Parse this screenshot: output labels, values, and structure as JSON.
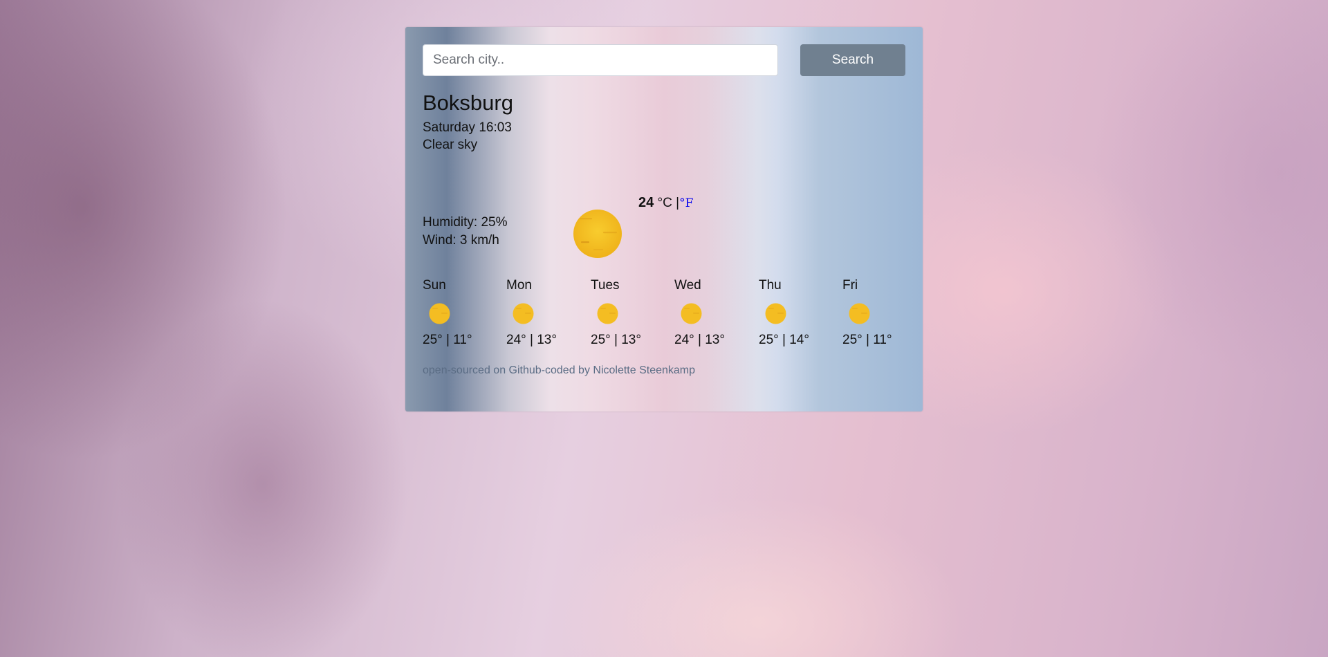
{
  "search": {
    "placeholder": "Search city..",
    "value": "",
    "button_label": "Search"
  },
  "current": {
    "city": "Boksburg",
    "datetime": "Saturday 16:03",
    "description": "Clear sky",
    "humidity": "Humidity: 25%",
    "wind": "Wind: 3 km/h",
    "temperature": "24",
    "unit_c": "°C |",
    "unit_f": "°F",
    "icon": "sun-icon"
  },
  "forecast": [
    {
      "day": "Sun",
      "temps": "25° | 11°",
      "icon": "sun-icon"
    },
    {
      "day": "Mon",
      "temps": "24° | 13°",
      "icon": "sun-icon"
    },
    {
      "day": "Tues",
      "temps": "25° | 13°",
      "icon": "sun-icon"
    },
    {
      "day": "Wed",
      "temps": "24° | 13°",
      "icon": "sun-icon"
    },
    {
      "day": "Thu",
      "temps": "25° | 14°",
      "icon": "sun-icon"
    },
    {
      "day": "Fri",
      "temps": "25° | 11°",
      "icon": "sun-icon"
    }
  ],
  "footer": {
    "link1": "open-sourced on Github",
    "separator": "-",
    "text": "coded by Nicolette Steenkamp"
  },
  "colors": {
    "button": "#708090",
    "link_blue": "#0000ee",
    "sun_yellow": "#f6c124"
  }
}
